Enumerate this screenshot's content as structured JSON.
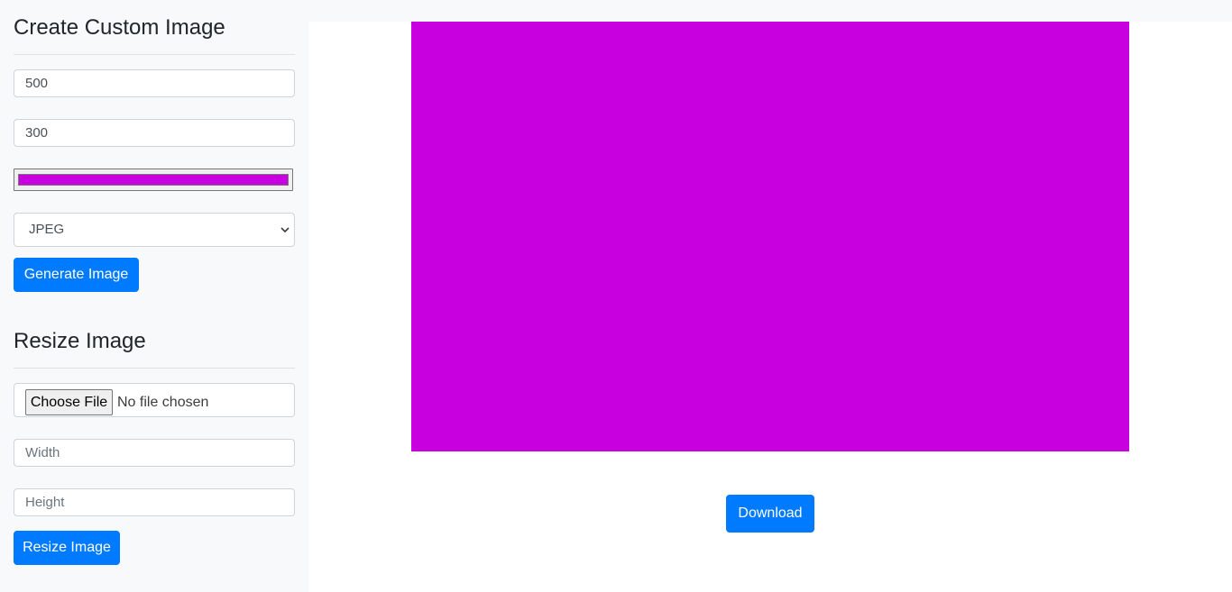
{
  "create": {
    "title": "Create Custom Image",
    "width_value": "500",
    "height_value": "300",
    "color_value": "#c800e0",
    "format_selected": "JPEG",
    "generate_label": "Generate Image"
  },
  "resize": {
    "title": "Resize Image",
    "choose_file_label": "Choose File",
    "file_status": "No file chosen",
    "width_placeholder": "Width",
    "height_placeholder": "Height",
    "resize_label": "Resize Image"
  },
  "preview": {
    "fill_color": "#c800e0",
    "download_label": "Download"
  },
  "colors": {
    "primary": "#007bff",
    "sidebar_bg": "#f8f9fa"
  },
  "icons": {
    "select_arrow": "chevron-down-icon"
  }
}
